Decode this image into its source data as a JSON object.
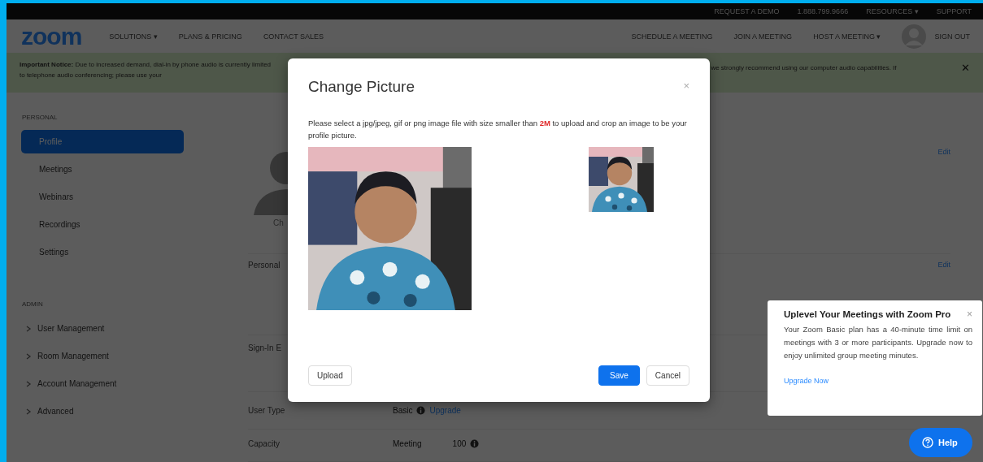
{
  "top_bar": {
    "links": [
      "REQUEST A DEMO",
      "1.888.799.9666",
      "RESOURCES ▾",
      "SUPPORT"
    ]
  },
  "nav": {
    "logo": "zoom",
    "left_links": [
      "SOLUTIONS ▾",
      "PLANS & PRICING",
      "CONTACT SALES"
    ],
    "right_links": [
      "SCHEDULE A MEETING",
      "JOIN A MEETING",
      "HOST A MEETING ▾"
    ],
    "sign_out": "SIGN OUT"
  },
  "notice": {
    "text_left": "**Important Notice:** Due to increased demand, dial-in by phone audio is currently limited to telephone audio conferencing; please use your",
    "text_right": "we strongly recommend using our computer audio capabilities. If",
    "close": "✕"
  },
  "sidebar": [
    {
      "heading": "PERSONAL",
      "items": [
        {
          "label": "Profile",
          "selected": true
        },
        {
          "label": "Meetings",
          "selected": false
        },
        {
          "label": "Webinars",
          "selected": false
        },
        {
          "label": "Recordings",
          "selected": false
        },
        {
          "label": "Settings",
          "selected": false
        }
      ]
    },
    {
      "heading": "ADMIN",
      "items": [
        {
          "label": "User Management",
          "selected": false,
          "expanded": false
        },
        {
          "label": "Room Management",
          "selected": false,
          "expanded": false
        },
        {
          "label": "Account Management",
          "selected": false,
          "expanded": false
        },
        {
          "label": "Advanced",
          "selected": false,
          "expanded": false
        }
      ]
    }
  ],
  "profile": {
    "change_link": "Ch",
    "edit": "Edit"
  },
  "rows": [
    {
      "kind": "edit",
      "label": "Personal",
      "edit": "Edit"
    },
    {
      "kind": "plain",
      "label": "Sign-In E"
    },
    {
      "kind": "upgrade",
      "label": "User Type",
      "value": "Basic",
      "link": "Upgrade"
    },
    {
      "kind": "capacity",
      "label": "Capacity",
      "name": "Meeting",
      "value": "100"
    }
  ],
  "modal": {
    "title": "Change Picture",
    "close": "×",
    "message": "Please select a jpg/jpeg, gif or png image file with size smaller than **2M** to upload and crop an image to be your profile picture.",
    "upload": "Upload",
    "save": "Save",
    "cancel": "Cancel"
  },
  "upsell": {
    "title": "Uplevel Your Meetings with Zoom Pro",
    "close": "×",
    "body": "Your Zoom Basic plan has a 40-minute time limit on meetings with 3 or more participants. Upgrade now to enjoy unlimited group meeting minutes.",
    "link": "Upgrade Now"
  },
  "help": {
    "label": "Help"
  }
}
